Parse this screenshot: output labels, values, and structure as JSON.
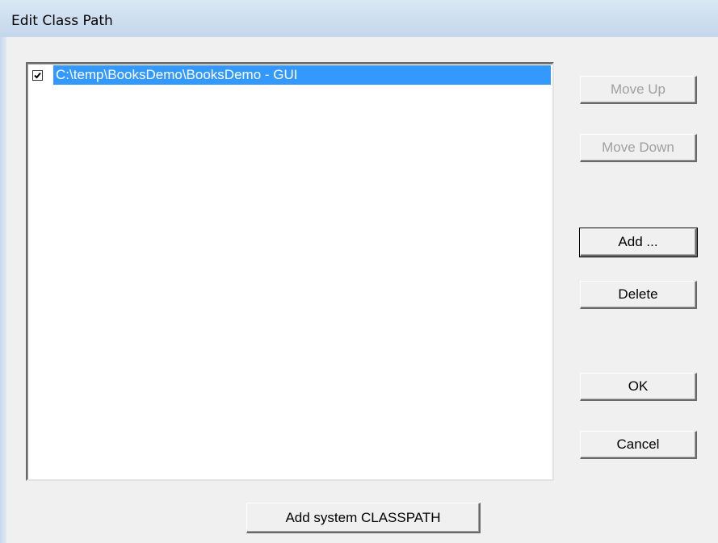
{
  "window": {
    "title": "Edit Class Path"
  },
  "classpath_list": {
    "items": [
      {
        "label": "C:\\temp\\BooksDemo\\BooksDemo - GUI",
        "checked": true,
        "selected": true
      }
    ]
  },
  "buttons": {
    "move_up": "Move Up",
    "move_down": "Move Down",
    "add": "Add ...",
    "delete": "Delete",
    "ok": "OK",
    "cancel": "Cancel",
    "add_system_classpath": "Add system CLASSPATH"
  },
  "colors": {
    "selection": "#3399ff",
    "dialog_bg": "#f0f0f0",
    "disabled_text": "#a0a0a0"
  }
}
